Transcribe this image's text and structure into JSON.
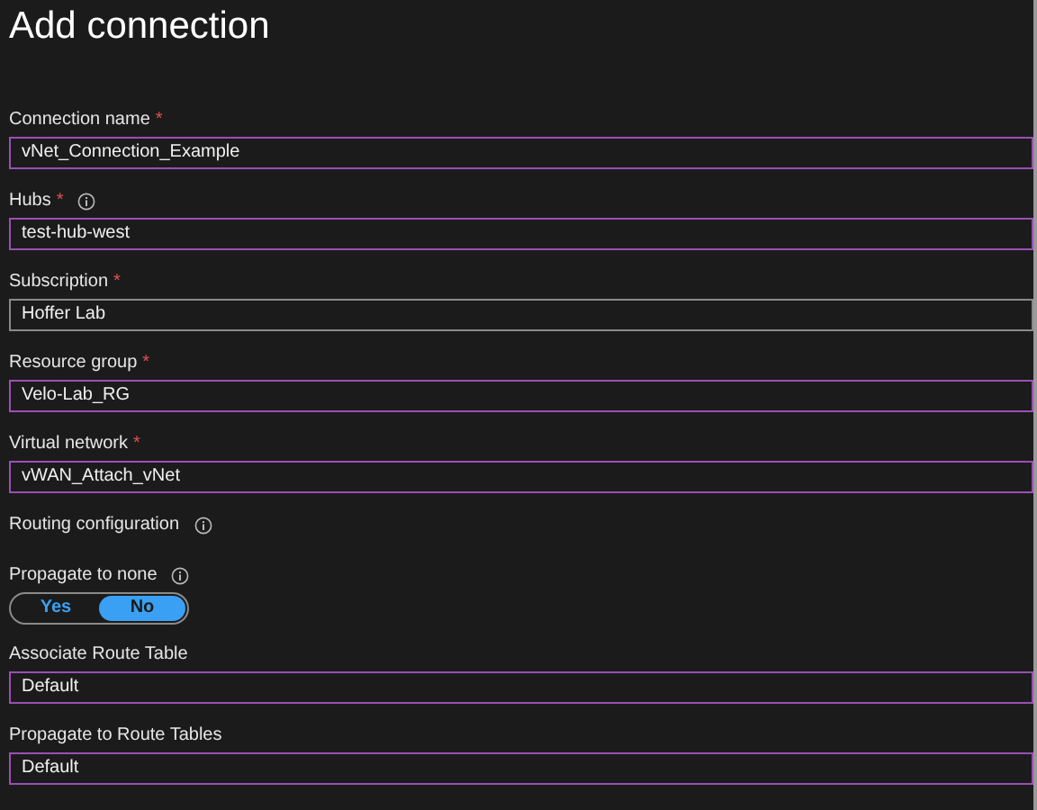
{
  "title": "Add connection",
  "items": [
    {
      "kind": "field",
      "label": "Connection name",
      "required_mark": "*",
      "info": false,
      "value": "vNet_Connection_Example",
      "highlighted": true
    },
    {
      "kind": "field",
      "label": "Hubs",
      "required_mark": "*",
      "info": true,
      "value": "test-hub-west",
      "highlighted": true
    },
    {
      "kind": "field",
      "label": "Subscription",
      "required_mark": "*",
      "info": false,
      "value": "Hoffer Lab",
      "highlighted": false
    },
    {
      "kind": "field",
      "label": "Resource group",
      "required_mark": "*",
      "info": false,
      "value": "Velo-Lab_RG",
      "highlighted": true
    },
    {
      "kind": "field",
      "label": "Virtual network",
      "required_mark": "*",
      "info": false,
      "value": "vWAN_Attach_vNet",
      "highlighted": true
    },
    {
      "kind": "section",
      "label": "Routing configuration",
      "info": true
    },
    {
      "kind": "toggle",
      "label": "Propagate to none",
      "info": true,
      "options": [
        {
          "label": "Yes",
          "selected": false
        },
        {
          "label": "No",
          "selected": true
        }
      ]
    },
    {
      "kind": "field",
      "label": "Associate Route Table",
      "info": false,
      "value": "Default",
      "highlighted": true
    },
    {
      "kind": "field",
      "label": "Propagate to Route Tables",
      "info": false,
      "value": "Default",
      "highlighted": true
    }
  ]
}
